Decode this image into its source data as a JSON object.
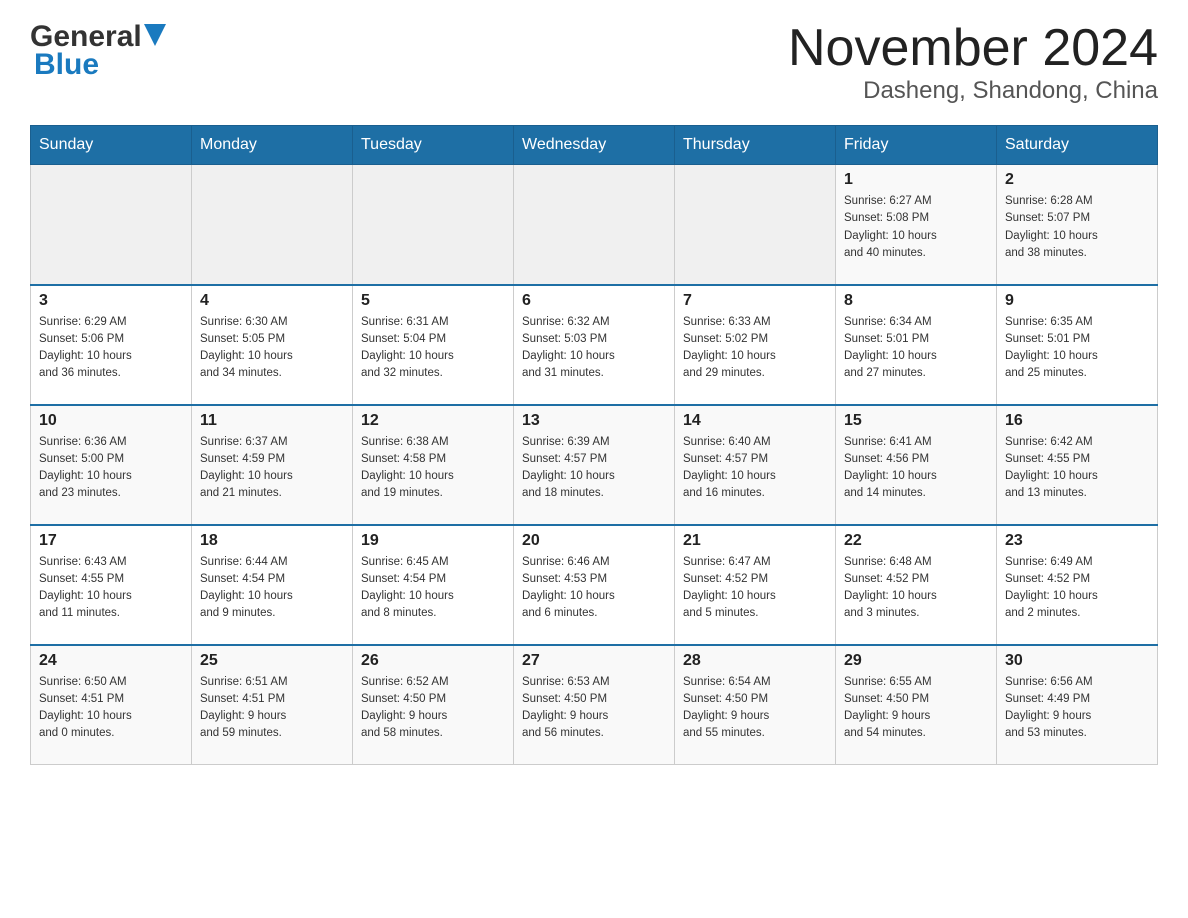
{
  "header": {
    "logo_general": "General",
    "logo_blue": "Blue",
    "month_title": "November 2024",
    "location": "Dasheng, Shandong, China"
  },
  "days_of_week": [
    "Sunday",
    "Monday",
    "Tuesday",
    "Wednesday",
    "Thursday",
    "Friday",
    "Saturday"
  ],
  "weeks": [
    [
      {
        "day": "",
        "info": ""
      },
      {
        "day": "",
        "info": ""
      },
      {
        "day": "",
        "info": ""
      },
      {
        "day": "",
        "info": ""
      },
      {
        "day": "",
        "info": ""
      },
      {
        "day": "1",
        "info": "Sunrise: 6:27 AM\nSunset: 5:08 PM\nDaylight: 10 hours\nand 40 minutes."
      },
      {
        "day": "2",
        "info": "Sunrise: 6:28 AM\nSunset: 5:07 PM\nDaylight: 10 hours\nand 38 minutes."
      }
    ],
    [
      {
        "day": "3",
        "info": "Sunrise: 6:29 AM\nSunset: 5:06 PM\nDaylight: 10 hours\nand 36 minutes."
      },
      {
        "day": "4",
        "info": "Sunrise: 6:30 AM\nSunset: 5:05 PM\nDaylight: 10 hours\nand 34 minutes."
      },
      {
        "day": "5",
        "info": "Sunrise: 6:31 AM\nSunset: 5:04 PM\nDaylight: 10 hours\nand 32 minutes."
      },
      {
        "day": "6",
        "info": "Sunrise: 6:32 AM\nSunset: 5:03 PM\nDaylight: 10 hours\nand 31 minutes."
      },
      {
        "day": "7",
        "info": "Sunrise: 6:33 AM\nSunset: 5:02 PM\nDaylight: 10 hours\nand 29 minutes."
      },
      {
        "day": "8",
        "info": "Sunrise: 6:34 AM\nSunset: 5:01 PM\nDaylight: 10 hours\nand 27 minutes."
      },
      {
        "day": "9",
        "info": "Sunrise: 6:35 AM\nSunset: 5:01 PM\nDaylight: 10 hours\nand 25 minutes."
      }
    ],
    [
      {
        "day": "10",
        "info": "Sunrise: 6:36 AM\nSunset: 5:00 PM\nDaylight: 10 hours\nand 23 minutes."
      },
      {
        "day": "11",
        "info": "Sunrise: 6:37 AM\nSunset: 4:59 PM\nDaylight: 10 hours\nand 21 minutes."
      },
      {
        "day": "12",
        "info": "Sunrise: 6:38 AM\nSunset: 4:58 PM\nDaylight: 10 hours\nand 19 minutes."
      },
      {
        "day": "13",
        "info": "Sunrise: 6:39 AM\nSunset: 4:57 PM\nDaylight: 10 hours\nand 18 minutes."
      },
      {
        "day": "14",
        "info": "Sunrise: 6:40 AM\nSunset: 4:57 PM\nDaylight: 10 hours\nand 16 minutes."
      },
      {
        "day": "15",
        "info": "Sunrise: 6:41 AM\nSunset: 4:56 PM\nDaylight: 10 hours\nand 14 minutes."
      },
      {
        "day": "16",
        "info": "Sunrise: 6:42 AM\nSunset: 4:55 PM\nDaylight: 10 hours\nand 13 minutes."
      }
    ],
    [
      {
        "day": "17",
        "info": "Sunrise: 6:43 AM\nSunset: 4:55 PM\nDaylight: 10 hours\nand 11 minutes."
      },
      {
        "day": "18",
        "info": "Sunrise: 6:44 AM\nSunset: 4:54 PM\nDaylight: 10 hours\nand 9 minutes."
      },
      {
        "day": "19",
        "info": "Sunrise: 6:45 AM\nSunset: 4:54 PM\nDaylight: 10 hours\nand 8 minutes."
      },
      {
        "day": "20",
        "info": "Sunrise: 6:46 AM\nSunset: 4:53 PM\nDaylight: 10 hours\nand 6 minutes."
      },
      {
        "day": "21",
        "info": "Sunrise: 6:47 AM\nSunset: 4:52 PM\nDaylight: 10 hours\nand 5 minutes."
      },
      {
        "day": "22",
        "info": "Sunrise: 6:48 AM\nSunset: 4:52 PM\nDaylight: 10 hours\nand 3 minutes."
      },
      {
        "day": "23",
        "info": "Sunrise: 6:49 AM\nSunset: 4:52 PM\nDaylight: 10 hours\nand 2 minutes."
      }
    ],
    [
      {
        "day": "24",
        "info": "Sunrise: 6:50 AM\nSunset: 4:51 PM\nDaylight: 10 hours\nand 0 minutes."
      },
      {
        "day": "25",
        "info": "Sunrise: 6:51 AM\nSunset: 4:51 PM\nDaylight: 9 hours\nand 59 minutes."
      },
      {
        "day": "26",
        "info": "Sunrise: 6:52 AM\nSunset: 4:50 PM\nDaylight: 9 hours\nand 58 minutes."
      },
      {
        "day": "27",
        "info": "Sunrise: 6:53 AM\nSunset: 4:50 PM\nDaylight: 9 hours\nand 56 minutes."
      },
      {
        "day": "28",
        "info": "Sunrise: 6:54 AM\nSunset: 4:50 PM\nDaylight: 9 hours\nand 55 minutes."
      },
      {
        "day": "29",
        "info": "Sunrise: 6:55 AM\nSunset: 4:50 PM\nDaylight: 9 hours\nand 54 minutes."
      },
      {
        "day": "30",
        "info": "Sunrise: 6:56 AM\nSunset: 4:49 PM\nDaylight: 9 hours\nand 53 minutes."
      }
    ]
  ]
}
